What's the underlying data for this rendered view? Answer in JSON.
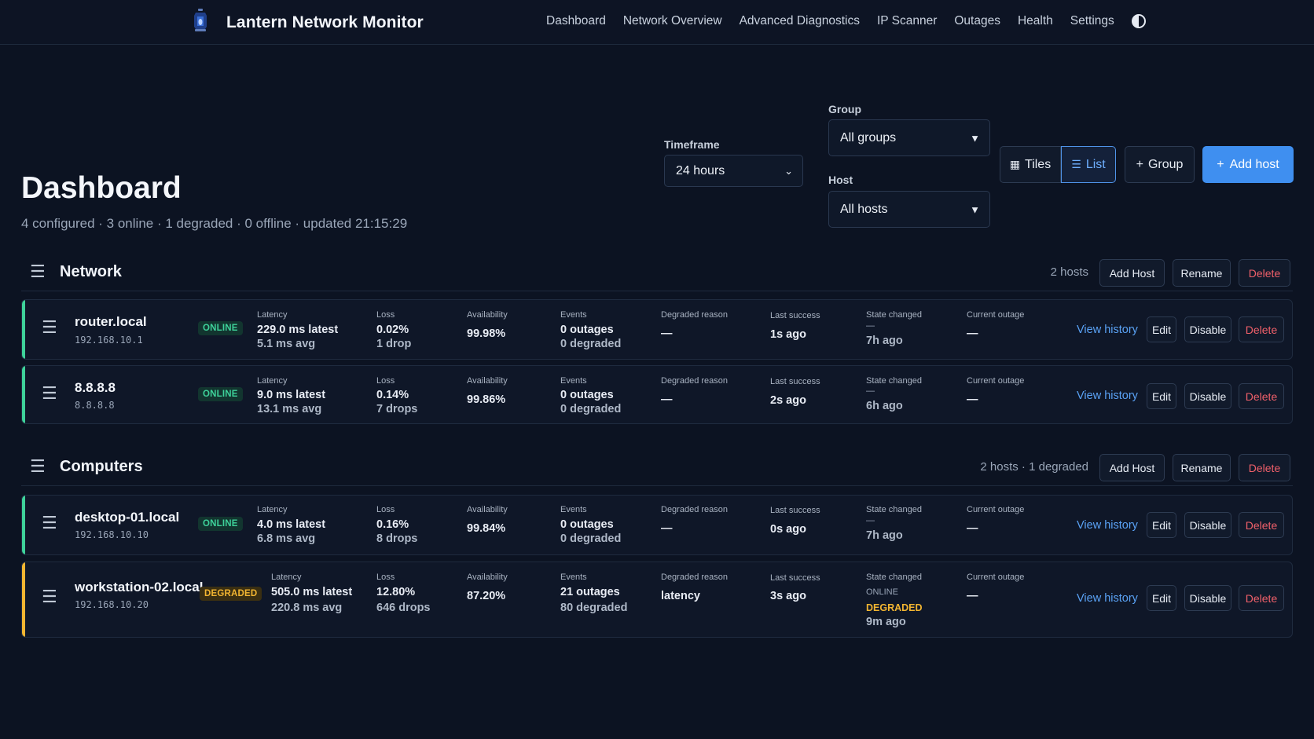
{
  "app": {
    "title": "Lantern Network Monitor",
    "logo_icon": "lantern-icon"
  },
  "nav": {
    "items": [
      "Dashboard",
      "Network Overview",
      "Advanced Diagnostics",
      "IP Scanner",
      "Outages",
      "Health",
      "Settings"
    ],
    "theme_icon": "contrast-icon"
  },
  "header": {
    "title": "Dashboard",
    "summary": "4 configured · 3 online · 1 degraded · 0 offline · updated 21:15:29"
  },
  "controls": {
    "timeframe_label": "Timeframe",
    "timeframe_value": "24 hours",
    "group_label": "Group",
    "group_value": "All groups",
    "host_label": "Host",
    "host_value": "All hosts",
    "tiles_label": "Tiles",
    "list_label": "List",
    "add_group_label": "Group",
    "add_host_label": "Add host"
  },
  "metric_labels": {
    "latency": "Latency",
    "loss": "Loss",
    "availability": "Availability",
    "events": "Events",
    "degraded_reason": "Degraded reason",
    "last_success": "Last success",
    "state_changed": "State changed",
    "current_outage": "Current outage"
  },
  "actions": {
    "view_history": "View history",
    "edit": "Edit",
    "disable": "Disable",
    "delete": "Delete",
    "add_host": "Add Host",
    "rename": "Rename"
  },
  "colors": {
    "online": "#3ed29a",
    "degraded": "#f2b531",
    "accent": "#3f8ff0",
    "danger": "#f0606a"
  },
  "groups": [
    {
      "name": "Network",
      "count": "2 hosts",
      "hosts": [
        {
          "name": "router.local",
          "ip": "192.168.10.1",
          "status": "ONLINE",
          "latency_latest": "229.0 ms latest",
          "latency_avg": "5.1 ms avg",
          "loss_pct": "0.02%",
          "loss_drops": "1 drop",
          "availability": "99.98%",
          "outages": "0 outages",
          "degraded": "0 degraded",
          "degraded_reason": "—",
          "last_success": "1s ago",
          "state_prev": "—",
          "state_new": "",
          "state_ago": "7h ago",
          "current_outage": "—"
        },
        {
          "name": "8.8.8.8",
          "ip": "8.8.8.8",
          "status": "ONLINE",
          "latency_latest": "9.0 ms latest",
          "latency_avg": "13.1 ms avg",
          "loss_pct": "0.14%",
          "loss_drops": "7 drops",
          "availability": "99.86%",
          "outages": "0 outages",
          "degraded": "0 degraded",
          "degraded_reason": "—",
          "last_success": "2s ago",
          "state_prev": "—",
          "state_new": "",
          "state_ago": "6h ago",
          "current_outage": "—"
        }
      ]
    },
    {
      "name": "Computers",
      "count": "2 hosts · 1 degraded",
      "hosts": [
        {
          "name": "desktop-01.local",
          "ip": "192.168.10.10",
          "status": "ONLINE",
          "latency_latest": "4.0 ms latest",
          "latency_avg": "6.8 ms avg",
          "loss_pct": "0.16%",
          "loss_drops": "8 drops",
          "availability": "99.84%",
          "outages": "0 outages",
          "degraded": "0 degraded",
          "degraded_reason": "—",
          "last_success": "0s ago",
          "state_prev": "—",
          "state_new": "",
          "state_ago": "7h ago",
          "current_outage": "—"
        },
        {
          "name": "workstation-02.local",
          "ip": "192.168.10.20",
          "status": "DEGRADED",
          "latency_latest": "505.0 ms latest",
          "latency_avg": "220.8 ms avg",
          "loss_pct": "12.80%",
          "loss_drops": "646 drops",
          "availability": "87.20%",
          "outages": "21 outages",
          "degraded": "80 degraded",
          "degraded_reason": "latency",
          "last_success": "3s ago",
          "state_prev": "ONLINE",
          "state_new": "DEGRADED",
          "state_ago": "9m ago",
          "current_outage": "—"
        }
      ]
    }
  ]
}
